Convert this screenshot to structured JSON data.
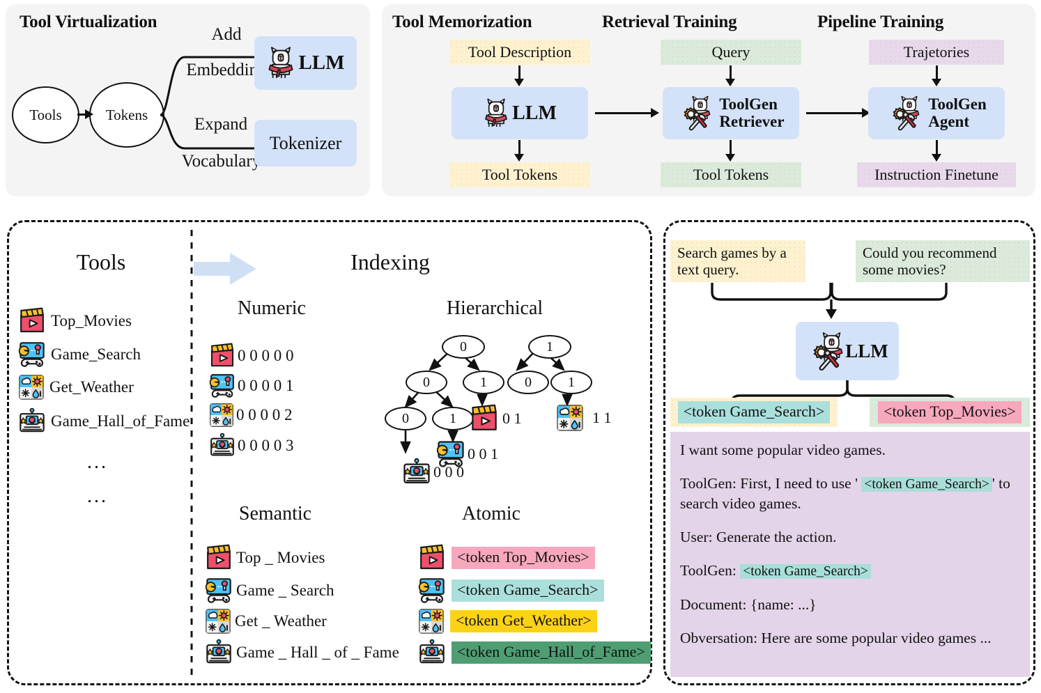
{
  "top_left": {
    "title": "Tool Virtualization",
    "node_tools": "Tools",
    "node_tokens": "Tokens",
    "edge_add": "Add",
    "edge_embedding": "Embedding",
    "edge_expand": "Expand",
    "edge_vocabulary": "Vocabulary",
    "llm_label": "LLM",
    "tokenizer_label": "Tokenizer"
  },
  "top_right": {
    "stages": [
      {
        "title": "Tool Memorization",
        "input": "Tool Description",
        "model": "LLM",
        "output": "Tool Tokens",
        "input_color": "#fdf1cf",
        "output_color": "#fdf1cf"
      },
      {
        "title": "Retrieval Training",
        "input": "Query",
        "model_line1": "ToolGen",
        "model_line2": "Retriever",
        "output": "Tool Tokens",
        "input_color": "#dbeada",
        "output_color": "#dbeada"
      },
      {
        "title": "Pipeline Training",
        "input": "Trajetories",
        "model_line1": "ToolGen",
        "model_line2": "Agent",
        "output": "Instruction Finetune",
        "input_color": "#e7d9ea",
        "output_color": "#e7d9ea"
      }
    ]
  },
  "bottom_left": {
    "tools_header": "Tools",
    "indexing_header": "Indexing",
    "tool_list": [
      {
        "icon": "movie-clapper-icon",
        "label": "Top_Movies"
      },
      {
        "icon": "game-controller-icon",
        "label": "Game_Search"
      },
      {
        "icon": "weather-grid-icon",
        "label": "Get_Weather"
      },
      {
        "icon": "game-hall-icon",
        "label": "Game_Hall_of_Fame"
      }
    ],
    "ellipsis_1": "...",
    "ellipsis_2": "...",
    "numeric": {
      "header": "Numeric",
      "rows": [
        {
          "icon": "movie-clapper-icon",
          "code": "0 0 0 0 0"
        },
        {
          "icon": "game-controller-icon",
          "code": "0 0 0 0 1"
        },
        {
          "icon": "weather-grid-icon",
          "code": "0 0 0 0 2"
        },
        {
          "icon": "game-hall-icon",
          "code": "0 0 0 0 3"
        }
      ]
    },
    "hierarchical": {
      "header": "Hierarchical",
      "nodes": {
        "root_left": "0",
        "root_right": "1",
        "l2_a": "0",
        "l2_b": "1",
        "l2_c": "0",
        "l2_d": "1",
        "l3_a": "0",
        "l3_b": "1"
      },
      "leaves": [
        {
          "icon": "movie-clapper-icon",
          "code": "0 1"
        },
        {
          "icon": "weather-grid-icon",
          "code": "1 1"
        },
        {
          "icon": "game-controller-icon",
          "code": "0 0 1"
        },
        {
          "icon": "game-hall-icon",
          "code": "0 0 0"
        }
      ]
    },
    "semantic": {
      "header": "Semantic",
      "rows": [
        {
          "icon": "movie-clapper-icon",
          "label": "Top _ Movies"
        },
        {
          "icon": "game-controller-icon",
          "label": "Game _ Search"
        },
        {
          "icon": "weather-grid-icon",
          "label": "Get _ Weather"
        },
        {
          "icon": "game-hall-icon",
          "label": "Game _ Hall _ of _ Fame"
        }
      ]
    },
    "atomic": {
      "header": "Atomic",
      "rows": [
        {
          "icon": "movie-clapper-icon",
          "token": "<token Top_Movies>",
          "color": "#f7a8bd"
        },
        {
          "icon": "game-controller-icon",
          "token": "<token Game_Search>",
          "color": "#abdfdb"
        },
        {
          "icon": "weather-grid-icon",
          "token": "<token Get_Weather>",
          "color": "#fcd217"
        },
        {
          "icon": "game-hall-icon",
          "token": "<token Game_Hall_of_Fame>",
          "color": "#4f9e73"
        }
      ]
    }
  },
  "bottom_right": {
    "query_left": "Search games by a text query.",
    "query_right": "Could you recommend some movies?",
    "model_label": "LLM",
    "out_left_token": "<token Game_Search>",
    "out_right_token": "<token Top_Movies>",
    "conversation": [
      "I want some popular video games.",
      "ToolGen: First, I need to use ' <token Game_Search> ' to search video games.",
      "User: Generate the action.",
      "ToolGen: <token Game_Search>",
      "Document: {name: ...}",
      "Obversation: Here are some popular video games ..."
    ],
    "conv_line_1": "I want some popular video games.",
    "conv_line_2a": "ToolGen: First, I need to use '",
    "conv_line_2b": "<token Game_Search>",
    "conv_line_2c": "'",
    "conv_line_2d": "to search video games.",
    "conv_line_3": "User: Generate the action.",
    "conv_line_4a": "ToolGen:",
    "conv_line_4b": "<token Game_Search>",
    "conv_line_5": "Document: {name: ...}",
    "conv_line_6": "Obversation: Here are some popular video games ..."
  },
  "colors": {
    "panel_bg": "#f4f4f4",
    "blue_box": "#d3e2f8",
    "yellow": "#fdf1cf",
    "green": "#dbeada",
    "purple": "#e7d9ea",
    "convo_bg": "#e3d4e9",
    "pink_token": "#f7a8bd",
    "cyan_token": "#abdfdb",
    "gold_token": "#fcd217",
    "green_token": "#4f9e73"
  }
}
